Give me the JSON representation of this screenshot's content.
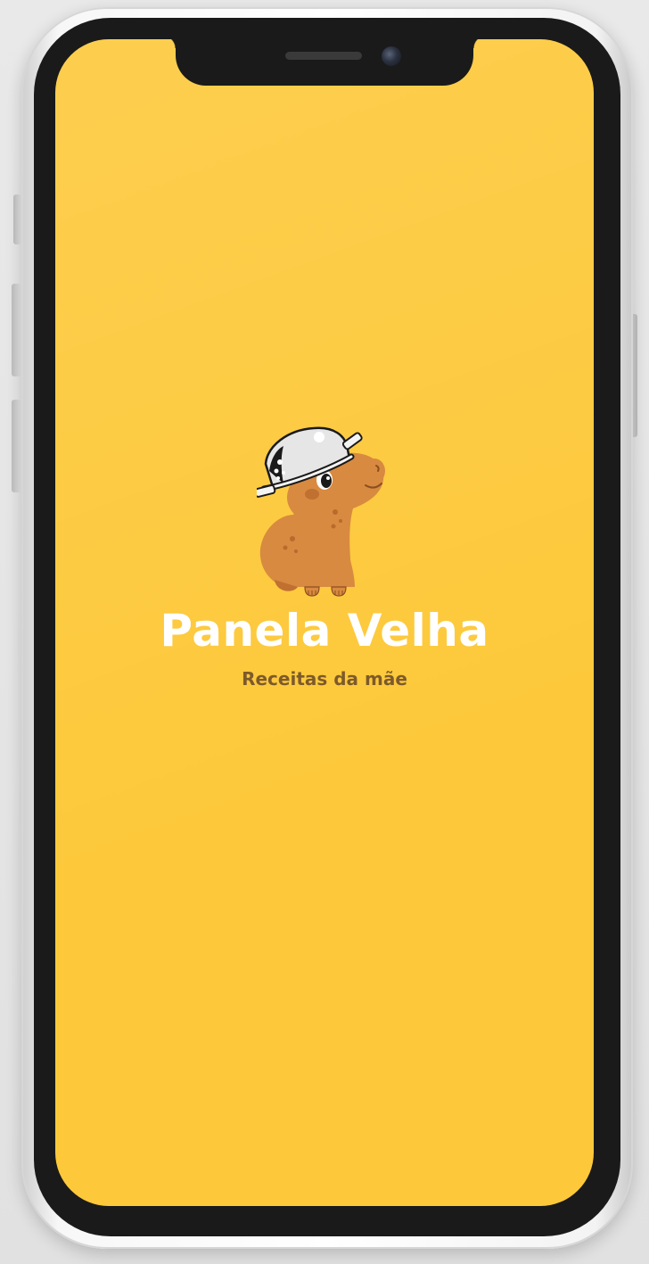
{
  "splash": {
    "title": "Panela Velha",
    "subtitle": "Receitas da mãe",
    "logo_icon": "capybara-with-pot-icon"
  },
  "colors": {
    "background": "#fdc93b",
    "title": "#ffffff",
    "subtitle": "#7d5a2a"
  }
}
